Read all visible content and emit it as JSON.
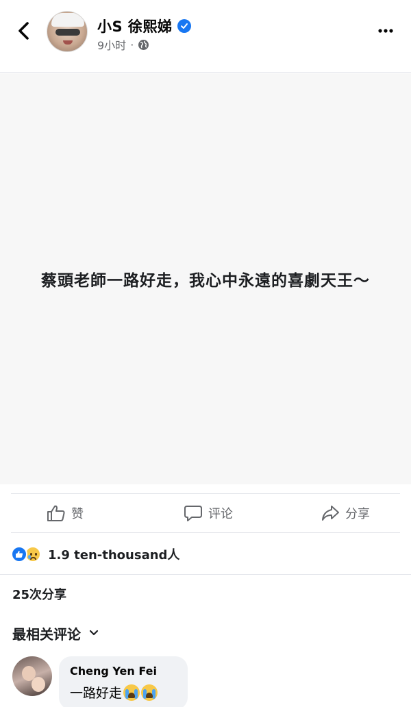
{
  "header": {
    "name": "小S 徐熙娣",
    "time": "9小时",
    "separator": "·",
    "icons": [
      "back-icon",
      "verified-badge-icon",
      "globe-icon",
      "more-icon"
    ]
  },
  "post": {
    "text": "蔡頭老師一路好走，我心中永遠的喜劇天王～",
    "background_color": "#f7f7f7"
  },
  "actions": [
    {
      "label": "赞",
      "icon": "like-icon"
    },
    {
      "label": "评论",
      "icon": "comment-icon"
    },
    {
      "label": "分享",
      "icon": "share-icon"
    }
  ],
  "reactions": {
    "count": "1.9 ten-thousand人",
    "icons": [
      "like-reaction-icon",
      "sad-reaction-icon"
    ]
  },
  "shares": "25次分享",
  "comments_sort": {
    "label": "最相关评论",
    "icon": "chevron-down-icon"
  },
  "comment": {
    "author": "Cheng Yen Fei",
    "text": "一路好走",
    "emoji": [
      "crying-face-icon",
      "crying-face-icon"
    ]
  },
  "colors": {
    "accent": "#1877f2",
    "secondary_text": "#65676b",
    "bubble": "#f0f2f5"
  }
}
